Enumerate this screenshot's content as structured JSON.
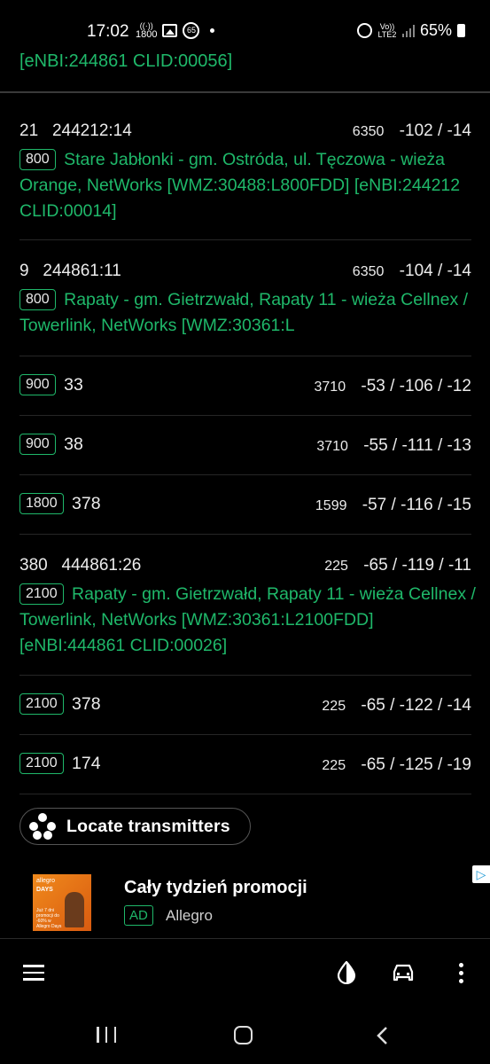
{
  "status_bar": {
    "time": "17:02",
    "band_indicator": "1800",
    "notification_count": "65",
    "network": "Vo)) LTE2",
    "battery": "65%"
  },
  "top_trail": "[eNBI:244861 CLID:00056]",
  "cells": [
    {
      "pci": "21",
      "id": "244212:14",
      "earfcn": "6350",
      "signal": "-102 / -14",
      "band": "800",
      "desc": "Stare Jabłonki - gm. Ostróda, ul. Tęczowa - wieża Orange, NetWorks [WMZ:30488:L800FDD] [eNBI:244212 CLID:00014]"
    },
    {
      "pci": "9",
      "id": "244861:11",
      "earfcn": "6350",
      "signal": "-104 / -14",
      "band": "800",
      "desc": "Rapaty - gm. Gietrzwałd, Rapaty 11 - wieża Cellnex / Towerlink, NetWorks [WMZ:30361:L"
    },
    {
      "band": "900",
      "pci": "33",
      "earfcn": "3710",
      "signal": "-53 / -106 / -12"
    },
    {
      "band": "900",
      "pci": "38",
      "earfcn": "3710",
      "signal": "-55 / -111 / -13"
    },
    {
      "band": "1800",
      "pci": "378",
      "earfcn": "1599",
      "signal": "-57 / -116 / -15"
    },
    {
      "pci": "380",
      "id": "444861:26",
      "earfcn": "225",
      "signal": "-65 / -119 / -11",
      "band": "2100",
      "desc": "Rapaty - gm. Gietrzwałd, Rapaty 11 - wieża Cellnex / Towerlink, NetWorks [WMZ:30361:L2100FDD] [eNBI:444861 CLID:00026]"
    },
    {
      "band": "2100",
      "pci": "378",
      "earfcn": "225",
      "signal": "-65 / -122 / -14"
    },
    {
      "band": "2100",
      "pci": "174",
      "earfcn": "225",
      "signal": "-65 / -125 / -19"
    }
  ],
  "locate_button": "Locate transmitters",
  "ad": {
    "title": "Cały tydzień promocji",
    "badge": "AD",
    "source": "Allegro",
    "thumb_brand": "allegro",
    "thumb_tag": "DAYS",
    "thumb_text": "Już 7 dni promocji do -60% w Allegro Days"
  },
  "colors": {
    "accent": "#1fb86a",
    "background": "#000000"
  }
}
